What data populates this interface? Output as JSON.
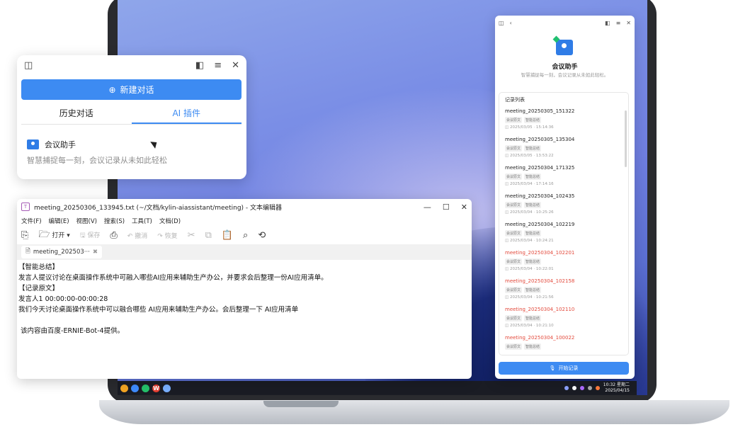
{
  "chat_window": {
    "new_chat_label": "新建对话",
    "tabs": [
      {
        "label": "历史对话",
        "active": false
      },
      {
        "label": "AI 插件",
        "active": true
      }
    ],
    "plugin": {
      "name": "会议助手",
      "description": "智慧捕捉每一刻，会议记录从未如此轻松"
    }
  },
  "editor": {
    "title": "meeting_20250306_133945.txt (~/文档/kylin-aiassistant/meeting) - 文本编辑器",
    "menu": [
      "文件(F)",
      "编辑(E)",
      "视图(V)",
      "搜索(S)",
      "工具(T)",
      "文档(D)"
    ],
    "toolbar": {
      "open": "打开",
      "save": "保存",
      "undo": "撤消",
      "redo": "恢复"
    },
    "tab_label": "meeting_202503···",
    "lines": [
      "【智能总结】",
      "发言人提议讨论在桌面操作系统中可融入哪些AI应用来辅助生产办公，并要求会后整理一份AI应用清单。",
      "【记录原文】",
      "发言人1 00:00:00-00:00:28",
      "我们今天讨论桌面操作系统中可以融合哪些 AI应用来辅助生产办公。会后整理一下 AI应用清单",
      "",
      " 该内容由百度-ERNIE-Bot-4提供。"
    ]
  },
  "panel": {
    "name": "会议助手",
    "subtitle": "智慧捕捉每一刻，会议记录从未如此轻松。",
    "list_header": "记录列表",
    "tags": [
      "会议原文",
      "智能总结"
    ],
    "records": [
      {
        "name": "meeting_20250305_151322",
        "time": "2025/03/05 · 15:14:36",
        "highlight": false
      },
      {
        "name": "meeting_20250305_135304",
        "time": "2025/03/05 · 13:53:22",
        "highlight": false
      },
      {
        "name": "meeting_20250304_171325",
        "time": "2025/03/04 · 17:14:16",
        "highlight": false
      },
      {
        "name": "meeting_20250304_102435",
        "time": "2025/03/04 · 10:25:26",
        "highlight": false
      },
      {
        "name": "meeting_20250304_102219",
        "time": "2025/03/04 · 10:24:21",
        "highlight": false
      },
      {
        "name": "meeting_20250304_102201",
        "time": "2025/03/04 · 10:22:01",
        "highlight": true
      },
      {
        "name": "meeting_20250304_102158",
        "time": "2025/03/04 · 10:21:56",
        "highlight": true
      },
      {
        "name": "meeting_20250304_102110",
        "time": "2025/03/04 · 10:21:10",
        "highlight": true
      },
      {
        "name": "meeting_20250304_100022",
        "time": "",
        "highlight": true
      }
    ],
    "start_label": "开始记录"
  },
  "taskbar": {
    "clock_time": "10:32 星期二",
    "clock_date": "2025/04/15"
  }
}
